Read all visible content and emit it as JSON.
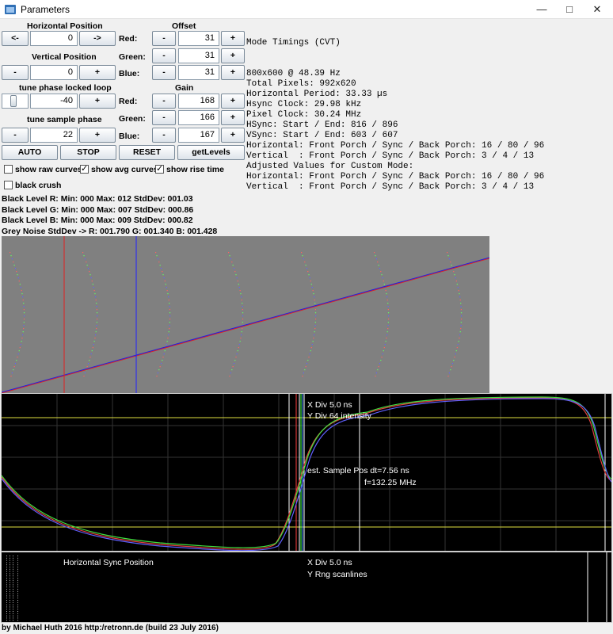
{
  "window": {
    "title": "Parameters"
  },
  "hpos": {
    "label": "Horizontal Position",
    "left_btn": "<-",
    "value": "0",
    "right_btn": "->"
  },
  "vpos": {
    "label": "Vertical Position",
    "minus": "-",
    "value": "0",
    "plus": "+"
  },
  "pll": {
    "label": "tune phase locked loop",
    "value": "-40",
    "plus": "+"
  },
  "sample": {
    "label": "tune sample phase",
    "minus": "-",
    "value": "22",
    "plus": "+"
  },
  "offset": {
    "label": "Offset",
    "rows": [
      {
        "color": "Red:",
        "minus": "-",
        "value": "31",
        "plus": "+"
      },
      {
        "color": "Green:",
        "minus": "-",
        "value": "31",
        "plus": "+"
      },
      {
        "color": "Blue:",
        "minus": "-",
        "value": "31",
        "plus": "+"
      }
    ]
  },
  "gain": {
    "label": "Gain",
    "rows": [
      {
        "color": "Red:",
        "minus": "-",
        "value": "168",
        "plus": "+"
      },
      {
        "color": "Green:",
        "minus": "-",
        "value": "166",
        "plus": "+"
      },
      {
        "color": "Blue:",
        "minus": "-",
        "value": "167",
        "plus": "+"
      }
    ]
  },
  "actions": {
    "auto": "AUTO",
    "stop": "STOP",
    "reset": "RESET",
    "levels": "getLevels"
  },
  "options": {
    "raw": {
      "label": "show raw curves",
      "checked": false
    },
    "avg": {
      "label": "show avg curves",
      "checked": true
    },
    "rise": {
      "label": "show rise time",
      "checked": true
    },
    "crush": {
      "label": "black crush",
      "checked": false
    }
  },
  "stats": [
    "Black Level R: Min: 000 Max: 012 StdDev: 001.03",
    "Black Level G: Min: 000 Max: 007 StdDev: 000.86",
    "Black Level B: Min: 000 Max: 009 StdDev: 000.82",
    "Grey Noise StdDev -> R: 001.790 G: 001.340 B: 001.428"
  ],
  "timings": [
    "Mode Timings (CVT)",
    "",
    "800x600 @ 48.39 Hz",
    "Total Pixels: 992x620",
    "Horizontal Period: 33.33 µs",
    "Hsync Clock: 29.98 kHz",
    "Pixel Clock: 30.24 MHz",
    "HSync: Start / End: 816 / 896",
    "VSync: Start / End: 603 / 607",
    "Horizontal: Front Porch / Sync / Back Porch: 16 / 80 / 96",
    "Vertical  : Front Porch / Sync / Back Porch: 3 / 4 / 13",
    "Adjusted Values for Custom Mode:",
    "Horizontal: Front Porch / Sync / Back Porch: 16 / 80 / 96",
    "Vertical  : Front Porch / Sync / Back Porch: 3 / 4 / 13"
  ],
  "scope": {
    "xdiv": "X Div 5.0 ns",
    "ydiv": "Y Div 64 intensity",
    "sample_pos": "est. Sample Pos dt=7.56 ns",
    "freq": "f=132.25 MHz"
  },
  "sync": {
    "title": "Horizontal Sync Position",
    "xdiv": "X Div 5.0 ns",
    "yrng": "Y Rng scanlines"
  },
  "footer": "by Michael Huth 2016 http:/retronn.de  (build 23 July 2016)"
}
